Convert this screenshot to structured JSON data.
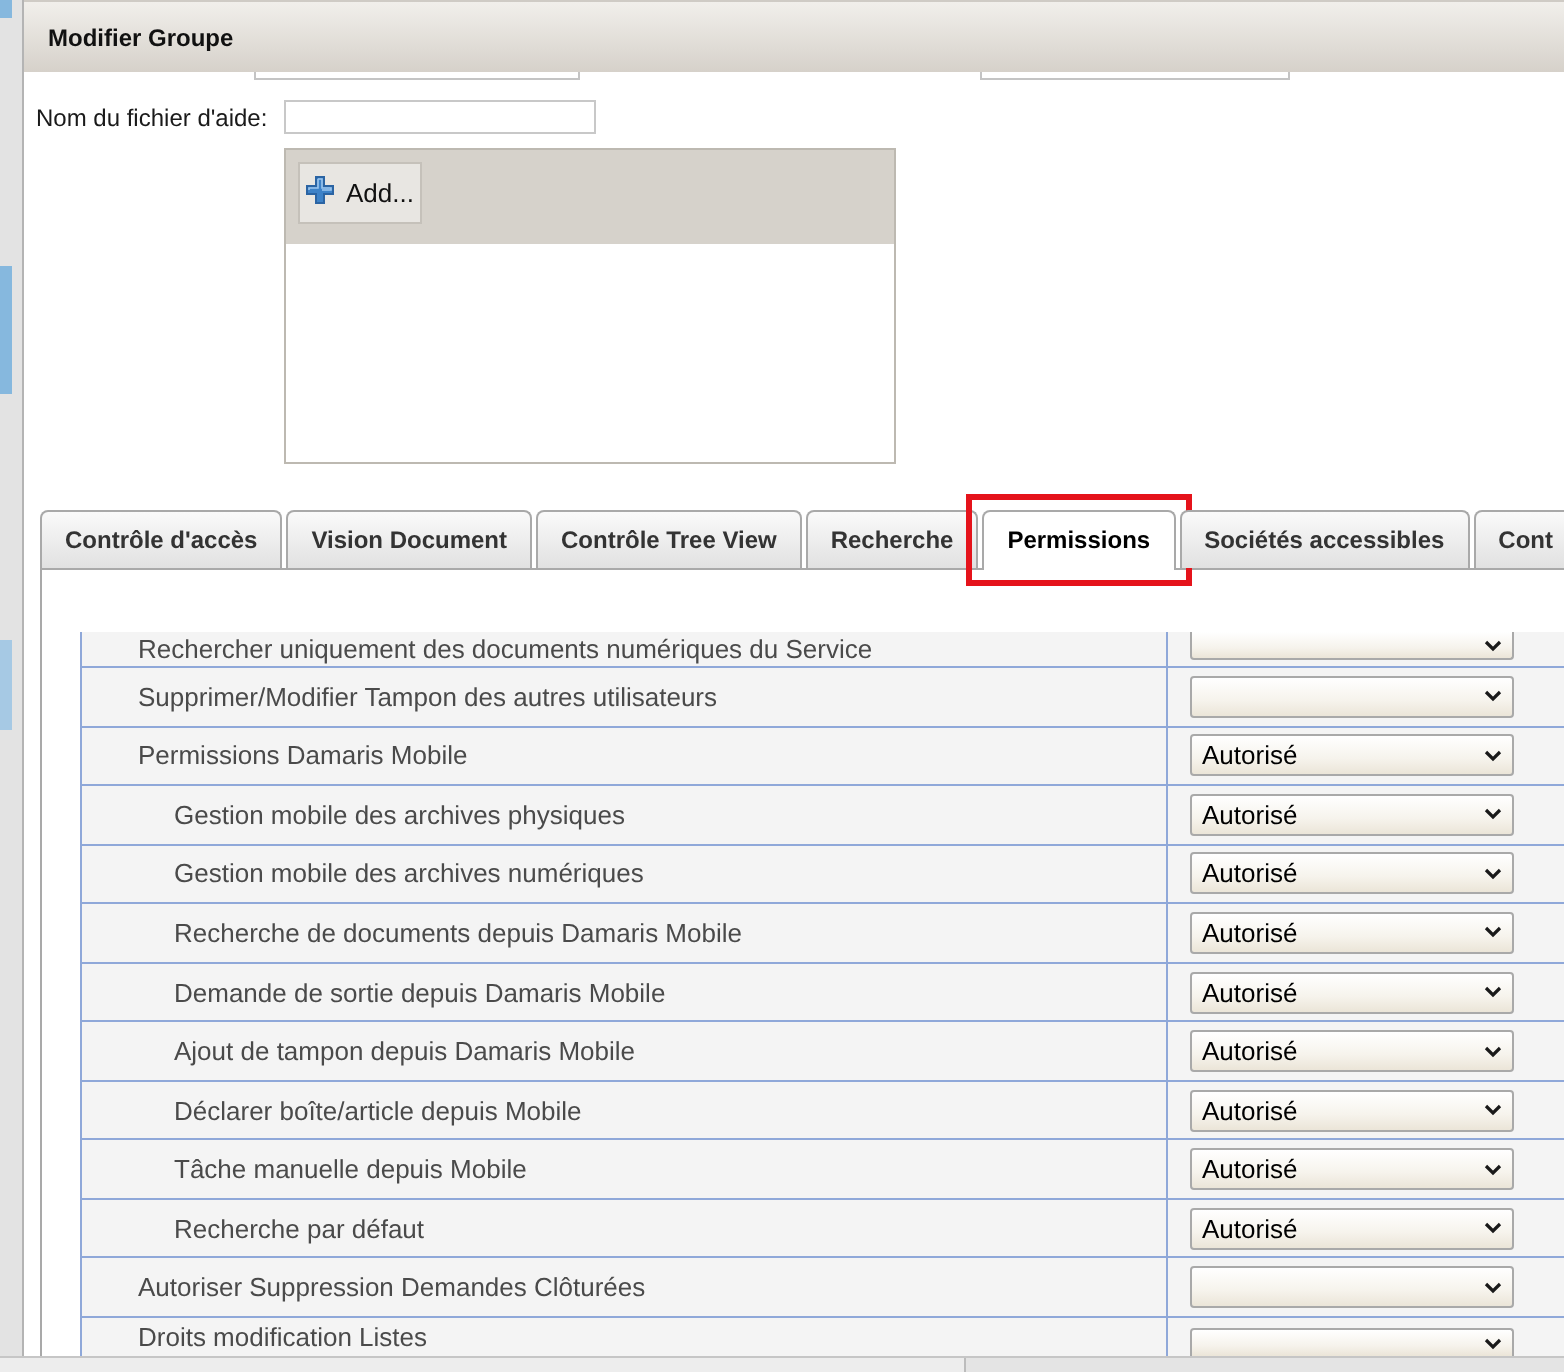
{
  "window": {
    "title": "Modifier Groupe"
  },
  "help_file": {
    "label": "Nom du fichier d'aide:"
  },
  "attachments": {
    "add_button": {
      "label": "Add..."
    }
  },
  "tabs": [
    {
      "label": "Contrôle d'accès",
      "selected": false,
      "highlighted": false
    },
    {
      "label": "Vision Document",
      "selected": false,
      "highlighted": false
    },
    {
      "label": "Contrôle Tree View",
      "selected": false,
      "highlighted": false
    },
    {
      "label": "Recherche",
      "selected": false,
      "highlighted": false
    },
    {
      "label": "Permissions",
      "selected": true,
      "highlighted": true
    },
    {
      "label": "Sociétés accessibles",
      "selected": false,
      "highlighted": false
    },
    {
      "label": "Cont",
      "selected": false,
      "highlighted": false
    }
  ],
  "permissions": {
    "rows": [
      {
        "label": "Rechercher uniquement des documents numériques du Service"
      },
      {
        "label": "Supprimer/Modifier Tampon des autres utilisateurs"
      },
      {
        "label": "Permissions Damaris Mobile",
        "value": "Autorisé",
        "children": [
          {
            "label": "Gestion mobile des archives physiques",
            "value": "Autorisé"
          },
          {
            "label": "Gestion mobile des archives numériques",
            "value": "Autorisé"
          },
          {
            "label": "Recherche de documents depuis Damaris Mobile",
            "value": "Autorisé"
          },
          {
            "label": "Demande de sortie depuis Damaris Mobile",
            "value": "Autorisé"
          },
          {
            "label": "Ajout de tampon depuis Damaris Mobile",
            "value": "Autorisé"
          },
          {
            "label": "Déclarer boîte/article depuis Mobile",
            "value": "Autorisé"
          },
          {
            "label": "Tâche manuelle depuis Mobile",
            "value": "Autorisé"
          },
          {
            "label": "Recherche par défaut",
            "value": "Autorisé"
          }
        ]
      },
      {
        "label": "Autoriser Suppression Demandes Clôturées"
      },
      {
        "label": "Droits modification Listes"
      }
    ]
  }
}
